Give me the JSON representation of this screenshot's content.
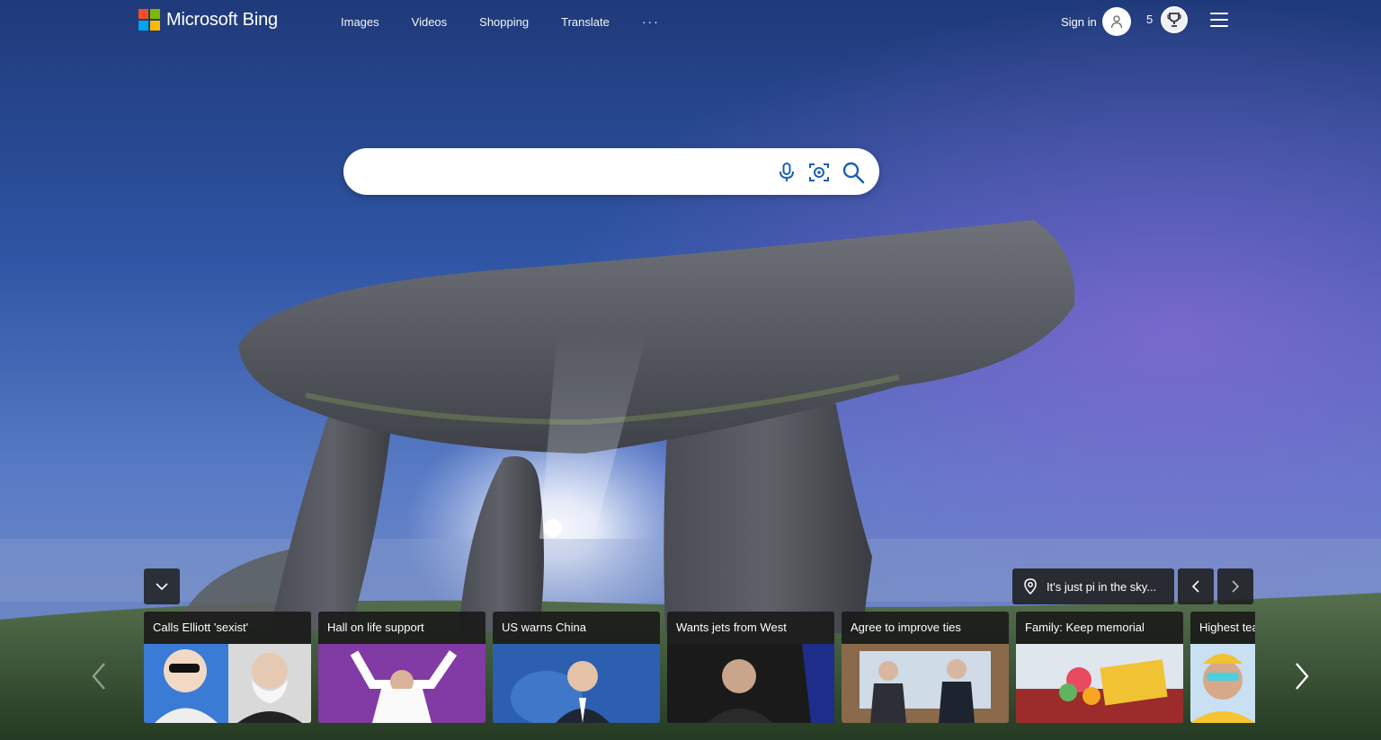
{
  "header": {
    "logo_text": "Microsoft Bing",
    "logo_colors": [
      "#f25022",
      "#7fba00",
      "#00a4ef",
      "#ffb900"
    ],
    "nav": [
      {
        "label": "Images"
      },
      {
        "label": "Videos"
      },
      {
        "label": "Shopping"
      },
      {
        "label": "Translate"
      }
    ],
    "more_label": "···",
    "sign_in_label": "Sign in",
    "rewards_count": "5"
  },
  "search": {
    "value": "",
    "icons": [
      "microphone-icon",
      "visual-search-icon",
      "search-icon"
    ]
  },
  "image_info": {
    "label": "It's just pi in the sky..."
  },
  "news": [
    {
      "title": "Calls Elliott 'sexist'"
    },
    {
      "title": "Hall on life support"
    },
    {
      "title": "US warns China"
    },
    {
      "title": "Wants jets from West"
    },
    {
      "title": "Agree to improve ties"
    },
    {
      "title": "Family: Keep memorial"
    },
    {
      "title": "Highest tea"
    }
  ]
}
